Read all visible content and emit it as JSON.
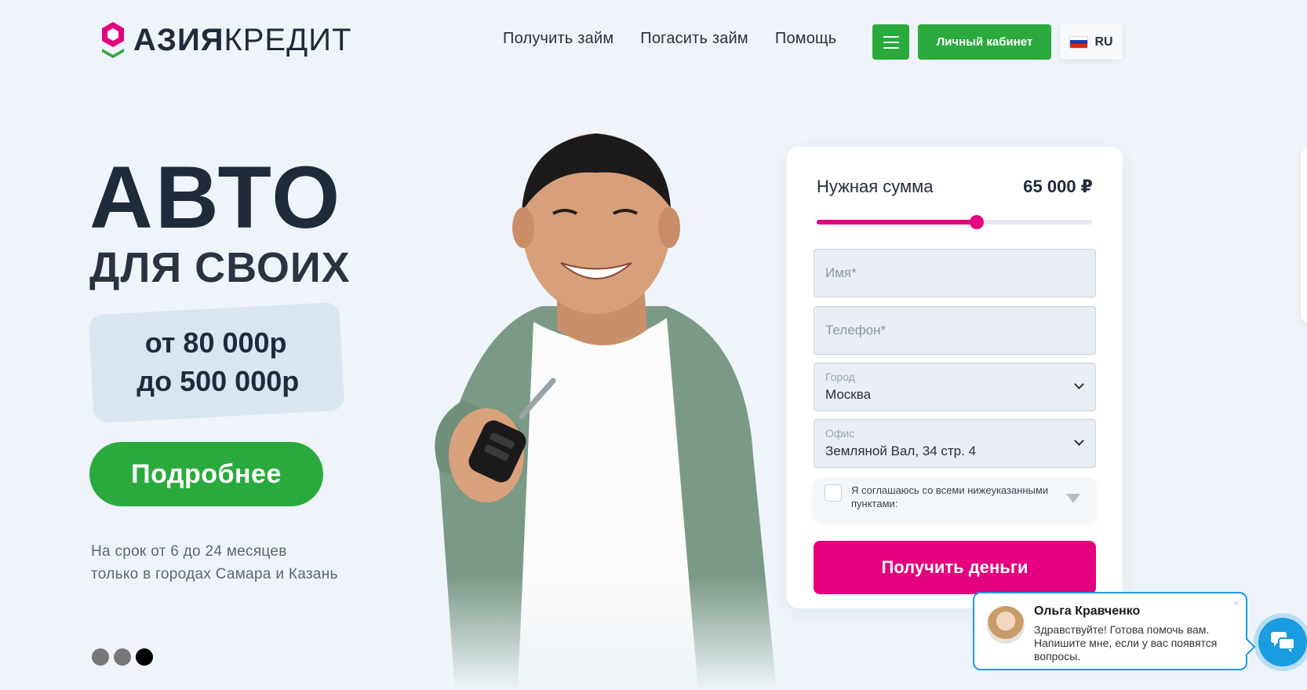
{
  "brand": {
    "logo_bold": "АЗИЯ",
    "logo_light": "КРЕДИТ"
  },
  "nav": [
    {
      "label": "Получить займ"
    },
    {
      "label": "Погасить займ"
    },
    {
      "label": "Помощь"
    }
  ],
  "header": {
    "cabinet_label": "Личный кабинет",
    "lang": "RU"
  },
  "hero": {
    "title": "АВТО",
    "subtitle": "ДЛЯ СВОИХ",
    "price_from": "от 80 000р",
    "price_to": "до 500 000р",
    "more_label": "Подробнее",
    "terms_line1": "На срок от 6 до 24 месяцев",
    "terms_line2": "только в городах Самара и Казань",
    "slides_total": 3,
    "active_slide": 3
  },
  "form": {
    "sum_label": "Нужная сумма",
    "sum_value": "65 000 ₽",
    "slider_fraction": 0.58,
    "name_placeholder": "Имя*",
    "phone_placeholder": "Телефон*",
    "city_label": "Город",
    "city_value": "Москва",
    "office_label": "Офис",
    "office_value": "Земляной Вал, 34 стр. 4",
    "agree_text": "Я соглашаюсь со всеми нижеуказанными пунктами:",
    "submit_label": "Получить деньги"
  },
  "chat": {
    "agent_name": "Ольга Кравченко",
    "message": "Здравствуйте! Готова помочь вам. Напишите мне, если у вас появятся вопросы.",
    "close": "×"
  },
  "colors": {
    "green": "#2aaa3d",
    "magenta": "#e4007e",
    "navy": "#1f2a3a",
    "chat_blue": "#1a9ce0"
  },
  "icons": [
    "logo-icon",
    "menu-icon",
    "flag-ru-icon",
    "chevron-down-icon",
    "triangle-down-icon",
    "chat-icon",
    "close-icon"
  ]
}
